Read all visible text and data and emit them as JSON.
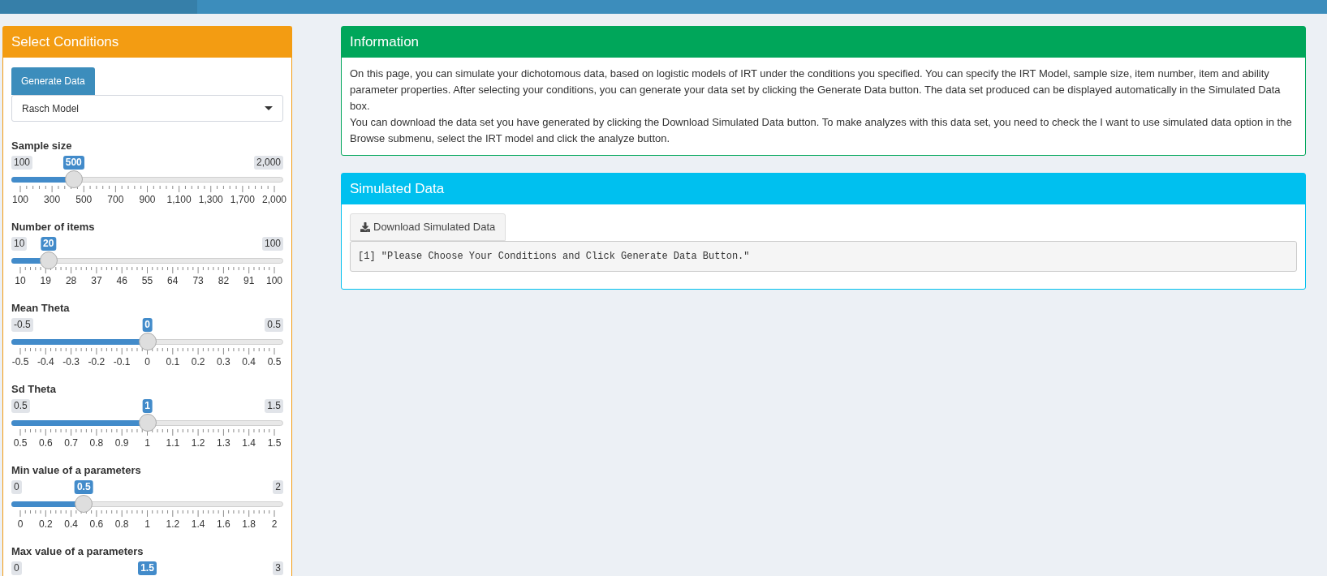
{
  "conditions_box": {
    "title": "Select Conditions",
    "generate_button": "Generate Data",
    "model_select": {
      "value": "Rasch Model"
    },
    "sliders": [
      {
        "label": "Sample size",
        "min": "100",
        "max": "2,000",
        "value": "500",
        "level": 0.21,
        "ticks": [
          "100",
          "300",
          "500",
          "700",
          "900",
          "1,100",
          "1,300",
          "1,700",
          "2,000"
        ]
      },
      {
        "label": "Number of items",
        "min": "10",
        "max": "100",
        "value": "20",
        "level": 0.111,
        "ticks": [
          "10",
          "19",
          "28",
          "37",
          "46",
          "55",
          "64",
          "73",
          "82",
          "91",
          "100"
        ]
      },
      {
        "label": "Mean Theta",
        "min": "-0.5",
        "max": "0.5",
        "value": "0",
        "level": 0.5,
        "ticks": [
          "-0.5",
          "-0.4",
          "-0.3",
          "-0.2",
          "-0.1",
          "0",
          "0.1",
          "0.2",
          "0.3",
          "0.4",
          "0.5"
        ]
      },
      {
        "label": "Sd Theta",
        "min": "0.5",
        "max": "1.5",
        "value": "1",
        "level": 0.5,
        "ticks": [
          "0.5",
          "0.6",
          "0.7",
          "0.8",
          "0.9",
          "1",
          "1.1",
          "1.2",
          "1.3",
          "1.4",
          "1.5"
        ]
      },
      {
        "label": "Min value of a parameters",
        "min": "0",
        "max": "2",
        "value": "0.5",
        "level": 0.25,
        "ticks": [
          "0",
          "0.2",
          "0.4",
          "0.6",
          "0.8",
          "1",
          "1.2",
          "1.4",
          "1.6",
          "1.8",
          "2"
        ]
      },
      {
        "label": "Max value of a parameters",
        "min": "0",
        "max": "3",
        "value": "1.5"
      }
    ]
  },
  "information_box": {
    "title": "Information",
    "paragraphs": [
      "On this page, you can simulate your dichotomous data, based on logistic models of IRT under the conditions you specified. You can specify the IRT Model, sample size, item number, item and ability parameter properties. After selecting your conditions, you can generate your data set by clicking the Generate Data button. The data set produced can be displayed automatically in the Simulated Data box.",
      "You can download the data set you have generated by clicking the Download Simulated Data button. To make analyzes with this data set, you need to check the I want to use simulated data option in the Browse submenu, select the IRT model and click the analyze button."
    ]
  },
  "simulated_data_box": {
    "title": "Simulated Data",
    "download_button": "Download Simulated Data",
    "output": "[1] \"Please Choose Your Conditions and Click Generate Data Button.\""
  }
}
